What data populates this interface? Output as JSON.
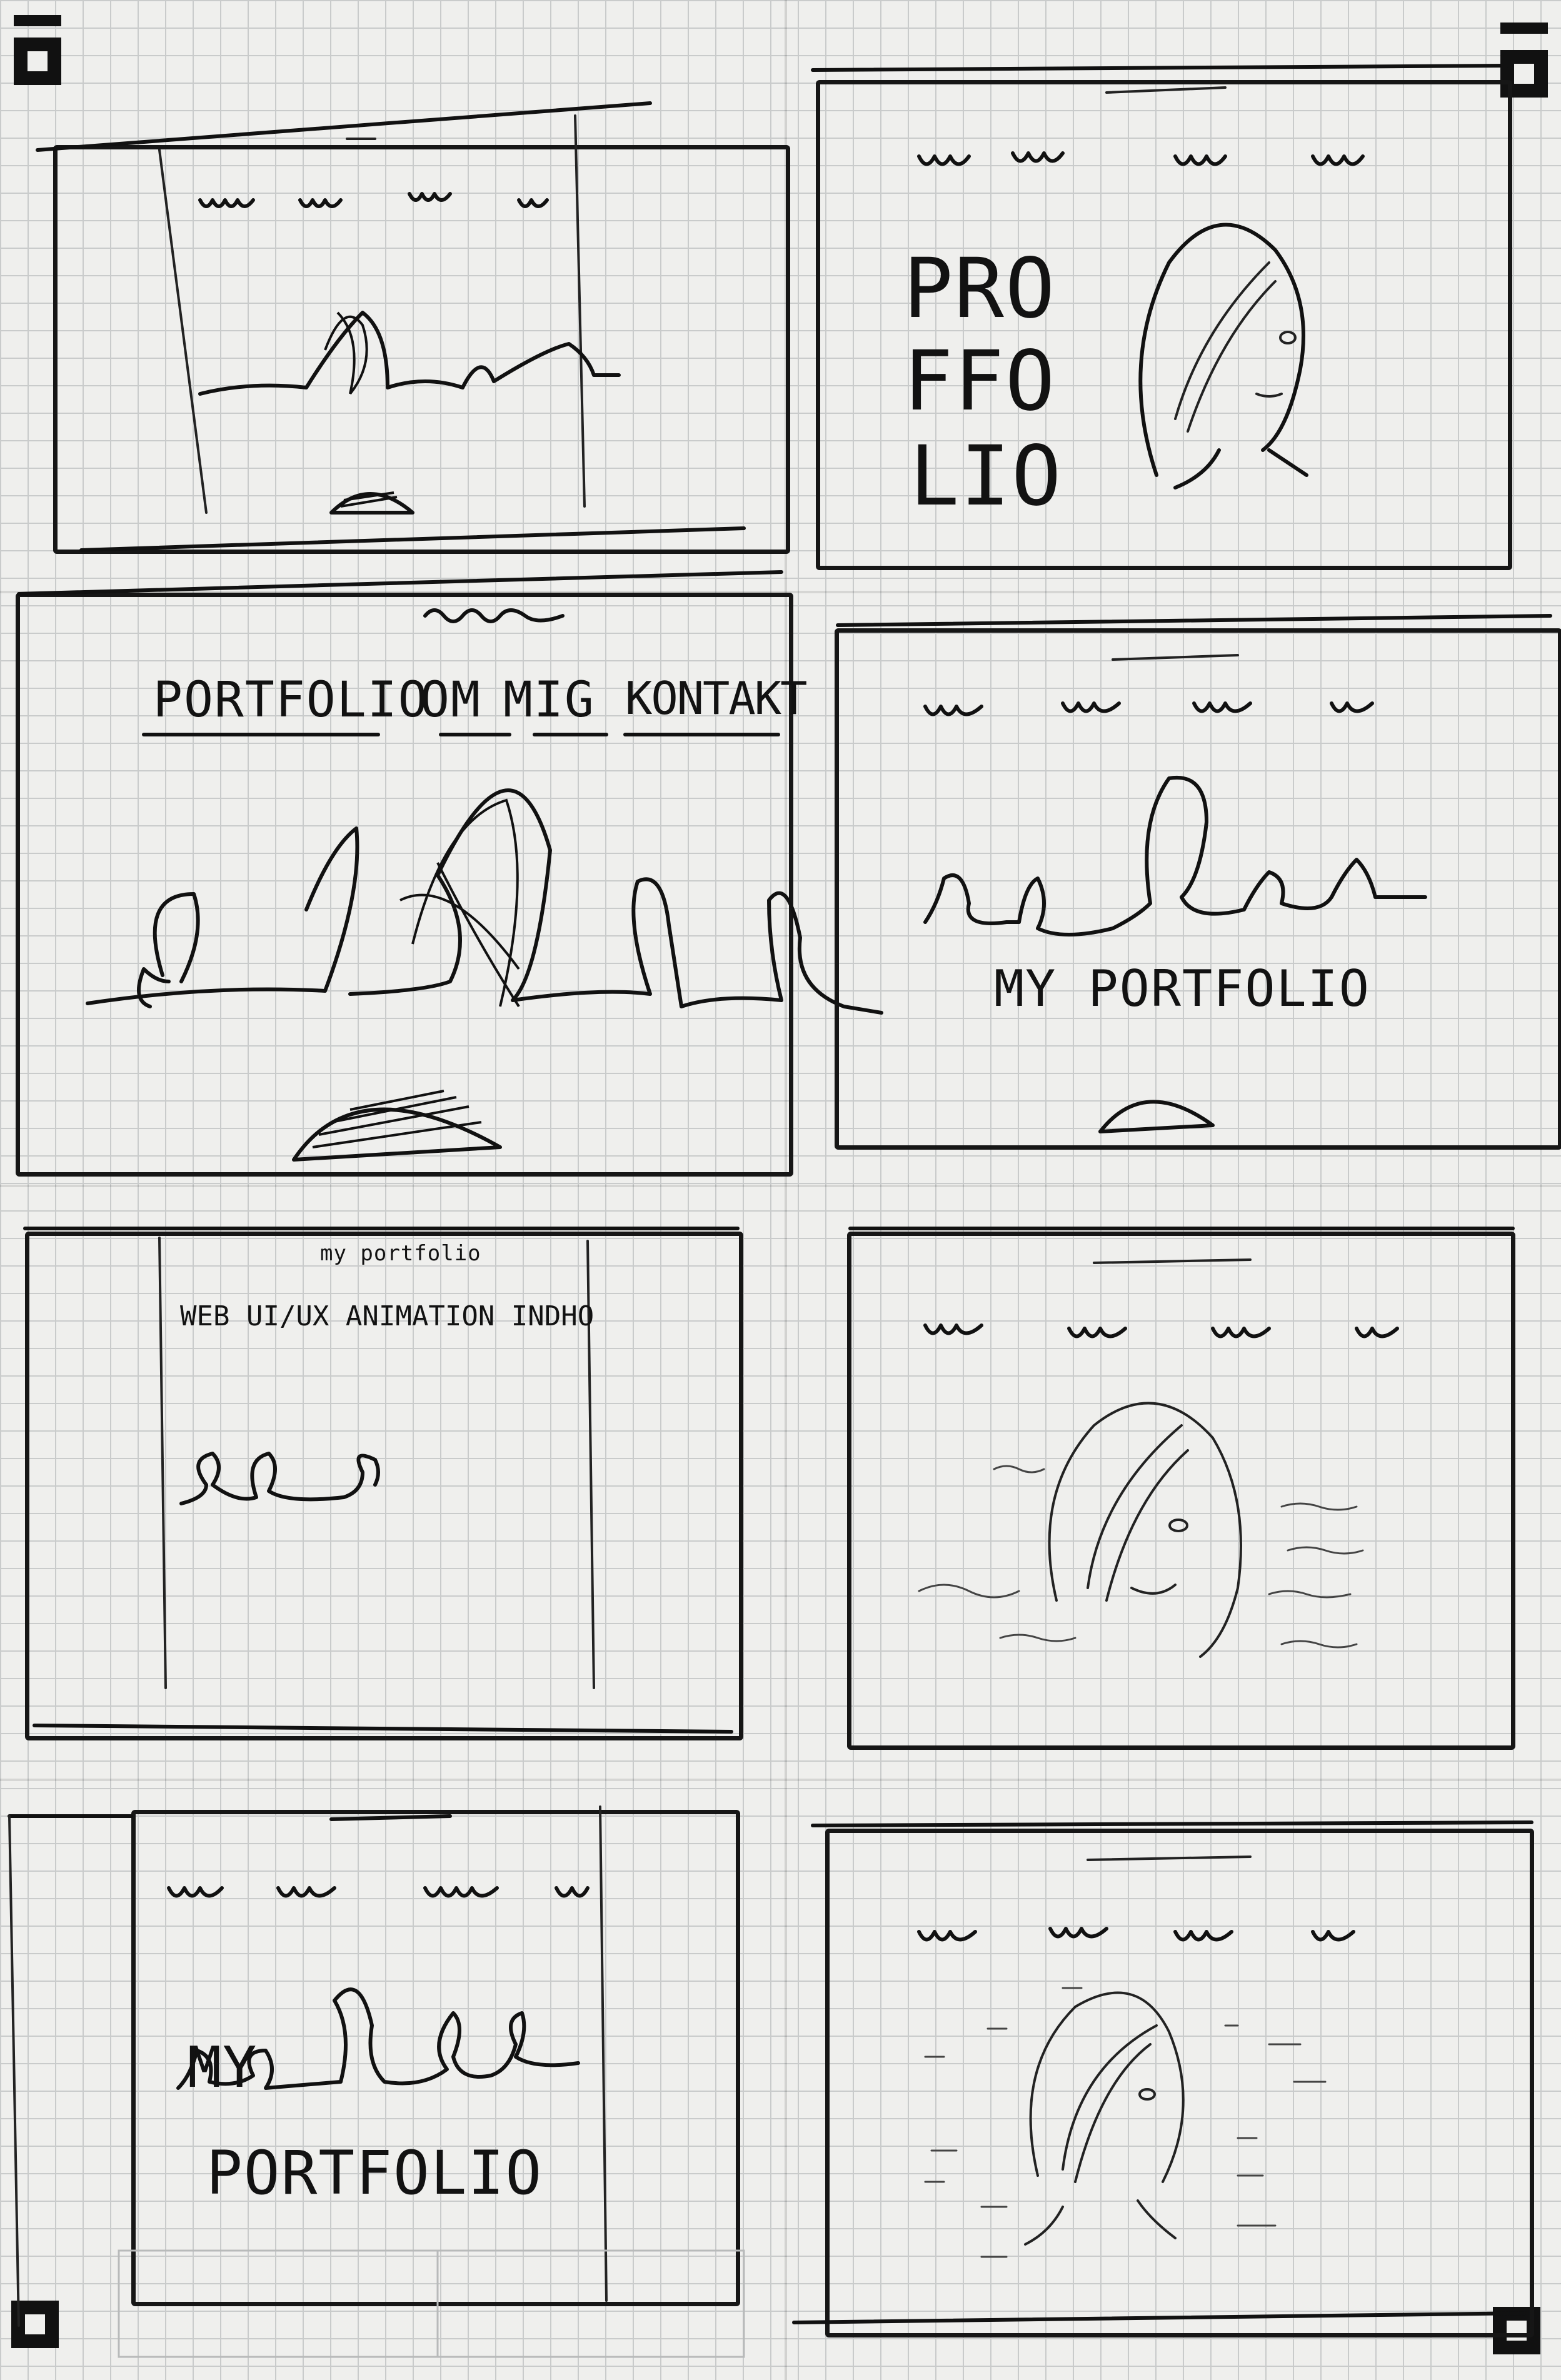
{
  "sheet": {
    "paper_color": "#efefed",
    "grid_color": "#c9cbcb",
    "ink_color": "#111111"
  },
  "sketches": [
    {
      "id": "s1",
      "texts": []
    },
    {
      "id": "s2",
      "logo_lines": [
        "PRO",
        "FFO",
        "LIO"
      ]
    },
    {
      "id": "s3",
      "nav": [
        "PORTFOLIO",
        "OM",
        "MIG",
        "KONTAKT"
      ]
    },
    {
      "id": "s4",
      "hero_title": "MY PORTFOLIO"
    },
    {
      "id": "s5",
      "header_title": "my portfolio",
      "nav_line": "WEB UI/UX ANIMATION INDHO"
    },
    {
      "id": "s6",
      "texts": []
    },
    {
      "id": "s7",
      "hero_line1": "MY",
      "hero_line2": "PORTFOLIO"
    },
    {
      "id": "s8",
      "texts": []
    }
  ],
  "icons": [
    "registration-marker-icon",
    "skyline-icon",
    "person-portrait-icon",
    "dome-icon"
  ]
}
